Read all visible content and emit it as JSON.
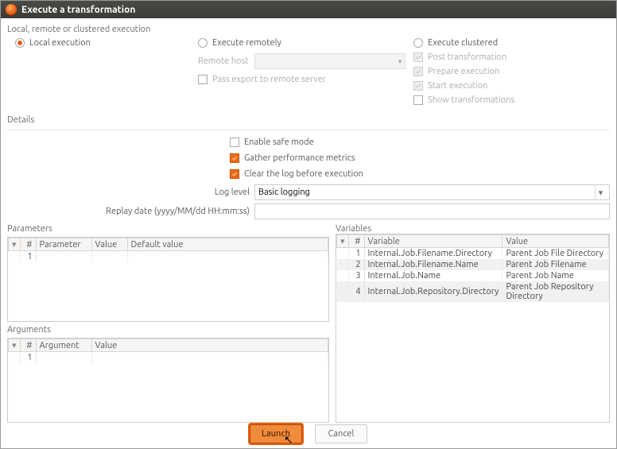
{
  "window": {
    "title": "Execute a transformation"
  },
  "exec": {
    "group": "Local, remote or clustered execution",
    "local": "Local execution",
    "remote": "Execute remotely",
    "remote_host_label": "Remote host",
    "pass_export": "Pass export to remote server",
    "clustered": "Execute clustered",
    "post_transform": "Post transformation",
    "prepare_exec": "Prepare execution",
    "start_exec": "Start execution",
    "show_transform": "Show transformations"
  },
  "details": {
    "group": "Details",
    "safe_mode": "Enable safe mode",
    "gather_metrics": "Gather performance metrics",
    "clear_log": "Clear the log before execution",
    "log_level_label": "Log level",
    "log_level_value": "Basic logging",
    "replay_label": "Replay date (yyyy/MM/dd HH:mm:ss)",
    "replay_value": ""
  },
  "parameters": {
    "label": "Parameters",
    "cols": {
      "num": "#",
      "parameter": "Parameter",
      "value": "Value",
      "default": "Default value"
    },
    "rows": [
      {
        "n": "1",
        "parameter": "",
        "value": "",
        "default": ""
      }
    ]
  },
  "arguments": {
    "label": "Arguments",
    "cols": {
      "num": "#",
      "argument": "Argument",
      "value": "Value"
    },
    "rows": [
      {
        "n": "1",
        "argument": "",
        "value": ""
      }
    ]
  },
  "variables": {
    "label": "Variables",
    "cols": {
      "num": "#",
      "variable": "Variable",
      "value": "Value"
    },
    "rows": [
      {
        "n": "1",
        "variable": "Internal.Job.Filename.Directory",
        "value": "Parent Job File Directory"
      },
      {
        "n": "2",
        "variable": "Internal.Job.Filename.Name",
        "value": "Parent Job Filename"
      },
      {
        "n": "3",
        "variable": "Internal.Job.Name",
        "value": "Parent Job Name"
      },
      {
        "n": "4",
        "variable": "Internal.Job.Repository.Directory",
        "value": "Parent Job Repository Directory"
      }
    ]
  },
  "buttons": {
    "launch": "Launch",
    "cancel": "Cancel"
  }
}
